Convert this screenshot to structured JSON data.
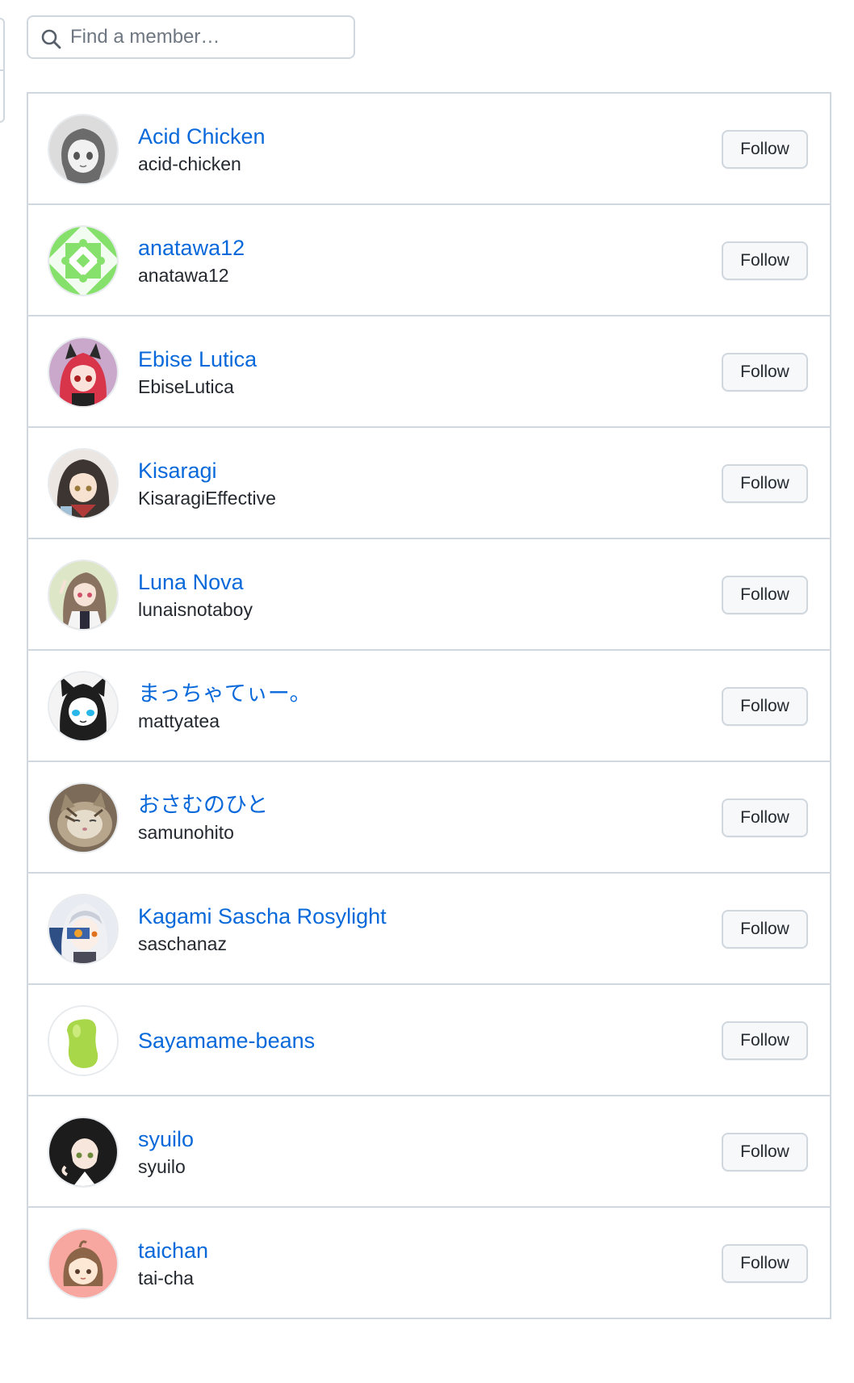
{
  "search": {
    "placeholder": "Find a member…"
  },
  "members": [
    {
      "display_name": "Acid Chicken",
      "login": "acid-chicken",
      "follow_label": "Follow",
      "avatar_bg": "#d9d9d9"
    },
    {
      "display_name": "anatawa12",
      "login": "anatawa12",
      "follow_label": "Follow",
      "avatar_bg": "#86e06c"
    },
    {
      "display_name": "Ebise Lutica",
      "login": "EbiseLutica",
      "follow_label": "Follow",
      "avatar_bg": "#c8a6c8"
    },
    {
      "display_name": "Kisaragi",
      "login": "KisaragiEffective",
      "follow_label": "Follow",
      "avatar_bg": "#e9e4df"
    },
    {
      "display_name": "Luna Nova",
      "login": "lunaisnotaboy",
      "follow_label": "Follow",
      "avatar_bg": "#dfe7c9"
    },
    {
      "display_name": "まっちゃてぃー。",
      "login": "mattyatea",
      "follow_label": "Follow",
      "avatar_bg": "#f2f2f2"
    },
    {
      "display_name": "おさむのひと",
      "login": "samunohito",
      "follow_label": "Follow",
      "avatar_bg": "#8a7a66"
    },
    {
      "display_name": "Kagami Sascha Rosylight",
      "login": "saschanaz",
      "follow_label": "Follow",
      "avatar_bg": "#3e5f8c"
    },
    {
      "display_name": "Sayamame-beans",
      "login": "",
      "follow_label": "Follow",
      "avatar_bg": "#ffffff"
    },
    {
      "display_name": "syuilo",
      "login": "syuilo",
      "follow_label": "Follow",
      "avatar_bg": "#2a2a2a"
    },
    {
      "display_name": "taichan",
      "login": "tai-cha",
      "follow_label": "Follow",
      "avatar_bg": "#f7a6a0"
    }
  ]
}
